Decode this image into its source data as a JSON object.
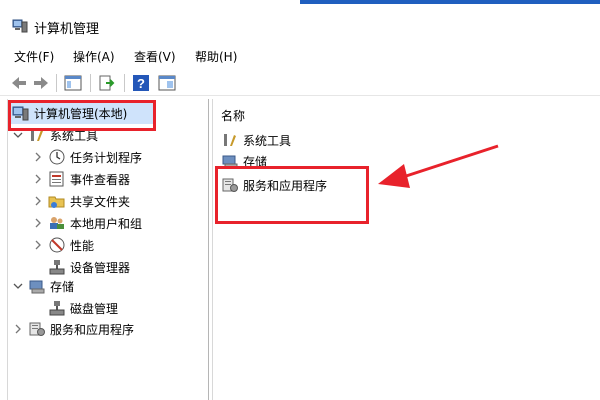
{
  "window": {
    "title": "计算机管理"
  },
  "menu": [
    {
      "label": "文件(F)"
    },
    {
      "label": "操作(A)"
    },
    {
      "label": "查看(V)"
    },
    {
      "label": "帮助(H)"
    }
  ],
  "toolbar": {
    "icons": [
      "back-arrow-icon",
      "forward-arrow-icon",
      "console-tree-icon",
      "export-list-icon",
      "help-icon",
      "properties-icon"
    ]
  },
  "tree": {
    "root": "计算机管理(本地)",
    "items": [
      {
        "label": "系统工具",
        "level": 1,
        "expanded": true
      },
      {
        "label": "任务计划程序",
        "level": 2
      },
      {
        "label": "事件查看器",
        "level": 2
      },
      {
        "label": "共享文件夹",
        "level": 2
      },
      {
        "label": "本地用户和组",
        "level": 2
      },
      {
        "label": "性能",
        "level": 2
      },
      {
        "label": "设备管理器",
        "level": 2
      },
      {
        "label": "存储",
        "level": 1,
        "expanded": true
      },
      {
        "label": "磁盘管理",
        "level": 2
      },
      {
        "label": "服务和应用程序",
        "level": 1,
        "expanded": false
      }
    ]
  },
  "content": {
    "column_header": "名称",
    "items": [
      {
        "label": "系统工具"
      },
      {
        "label": "存储"
      },
      {
        "label": "服务和应用程序"
      }
    ]
  },
  "colors": {
    "highlight": "#e8222b",
    "selection": "#cfe3fb",
    "titlebar_accent": "#1f5fbf"
  }
}
